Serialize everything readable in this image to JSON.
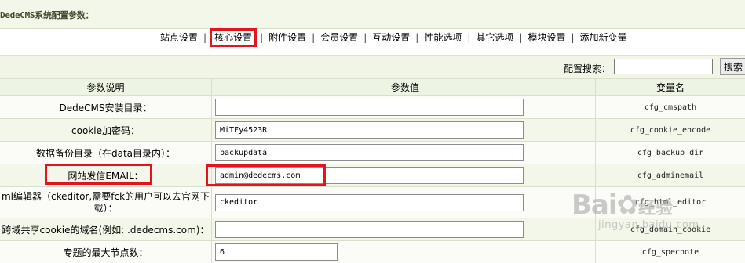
{
  "header": {
    "title": "DedeCMS系统配置参数："
  },
  "tabs": [
    {
      "label": "站点设置"
    },
    {
      "label": "核心设置"
    },
    {
      "label": "附件设置"
    },
    {
      "label": "会员设置"
    },
    {
      "label": "互动设置"
    },
    {
      "label": "性能选项"
    },
    {
      "label": "其它选项"
    },
    {
      "label": "模块设置"
    },
    {
      "label": "添加新变量"
    }
  ],
  "tab_separator": "|",
  "search": {
    "label": "配置搜索：",
    "value": "",
    "button": "搜索"
  },
  "table": {
    "headers": [
      "参数说明",
      "参数值",
      "变量名"
    ],
    "rows": [
      {
        "label": "DedeCMS安装目录：",
        "value": "",
        "var": "cfg_cmspath"
      },
      {
        "label": "cookie加密码：",
        "value": "MiTFy4523R",
        "var": "cfg_cookie_encode"
      },
      {
        "label": "数据备份目录（在data目录内）：",
        "value": "backupdata",
        "var": "cfg_backup_dir"
      },
      {
        "label": "网站发信EMAIL：",
        "value": "admin@dedecms.com",
        "var": "cfg_adminemail"
      },
      {
        "label": "ml编辑器（ckeditor,需要fck的用户可以去官网下载）：",
        "value": "ckeditor",
        "var": "cfg_html_editor"
      },
      {
        "label": "跨域共享cookie的域名(例如: .dedecms.com)：",
        "value": "",
        "var": "cfg_domain_cookie"
      },
      {
        "label": "专题的最大节点数：",
        "value": "6",
        "var": "cfg_specnote"
      }
    ]
  },
  "watermark": {
    "brand": "Bai",
    "brand_cn": "经验",
    "url": "jingyan.baidu.com"
  },
  "colors": {
    "highlight": "#e3141f",
    "header_bg": "#eef4e3"
  }
}
